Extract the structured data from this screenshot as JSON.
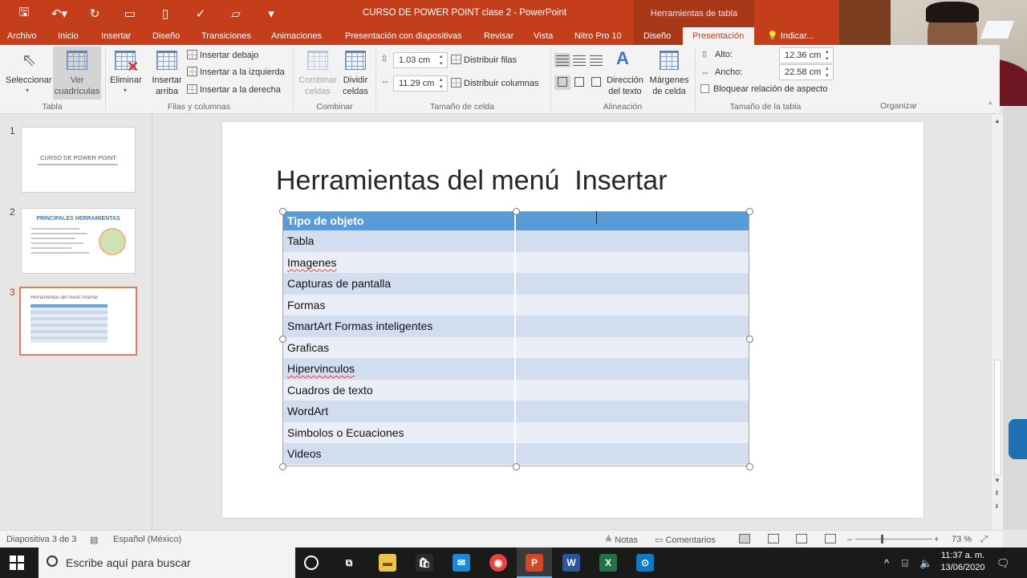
{
  "window": {
    "title": "CURSO DE POWER POINT clase 2  -  PowerPoint",
    "context_header": "Herramientas de tabla"
  },
  "tabs": [
    "Archivo",
    "Inicio",
    "Insertar",
    "Diseño",
    "Transiciones",
    "Animaciones",
    "Presentación con diapositivas",
    "Revisar",
    "Vista",
    "Nitro Pro 10",
    "Diseño",
    "Presentación",
    "Indicar..."
  ],
  "ribbon": {
    "seleccionar": "Seleccionar",
    "ver_cuadriculas_1": "Ver",
    "ver_cuadriculas_2": "cuadrículas",
    "eliminar": "Eliminar",
    "insertar_arriba_1": "Insertar",
    "insertar_arriba_2": "arriba",
    "insertar_debajo": "Insertar debajo",
    "insertar_izquierda": "Insertar a la izquierda",
    "insertar_derecha": "Insertar a la derecha",
    "combinar_celdas_1": "Combinar",
    "combinar_celdas_2": "celdas",
    "dividir_celdas_1": "Dividir",
    "dividir_celdas_2": "celdas",
    "cell_height": "1.03 cm",
    "cell_width": "11.29 cm",
    "distribuir_filas": "Distribuir filas",
    "distribuir_columnas": "Distribuir columnas",
    "direccion_texto_1": "Dirección",
    "direccion_texto_2": "del texto",
    "margenes_1": "Márgenes",
    "margenes_2": "de celda",
    "alto_label": "Alto:",
    "alto_value": "12.36 cm",
    "ancho_label": "Ancho:",
    "ancho_value": "22.58 cm",
    "bloquear": "Bloquear relación de aspecto",
    "organizar": "Organizar",
    "groups": {
      "tabla": "Tabla",
      "filas_columnas": "Filas y columnas",
      "combinar": "Combinar",
      "tamano_celda": "Tamaño de celda",
      "alineacion": "Alineación",
      "tamano_tabla": "Tamaño de la tabla"
    }
  },
  "thumbnails": {
    "nums": [
      "1",
      "2",
      "3"
    ],
    "slide1_title": "CURSO DE POWER POINT",
    "slide2_title": "PRINCIPALES HERRAMIENTAS",
    "slide3_title": "Herramientas del menú  Insertar"
  },
  "slide": {
    "title": "Herramientas del menú  Insertar",
    "table_header": [
      "Tipo de objeto",
      ""
    ],
    "rows": [
      "Tabla",
      "Imagenes",
      "Capturas de pantalla",
      "Formas",
      "SmartArt  Formas inteligentes",
      "Graficas",
      "Hipervinculos",
      "Cuadros de texto",
      "WordArt",
      "Simbolos o Ecuaciones",
      "Videos"
    ]
  },
  "status": {
    "slide_of": "Diapositiva 3 de 3",
    "language": "Español (México)",
    "notes": "Notas",
    "comments": "Comentarios",
    "zoom": "73 %"
  },
  "taskbar": {
    "search_placeholder": "Escribe aquí para buscar",
    "time": "11:37 a. m.",
    "date": "13/06/2020"
  }
}
